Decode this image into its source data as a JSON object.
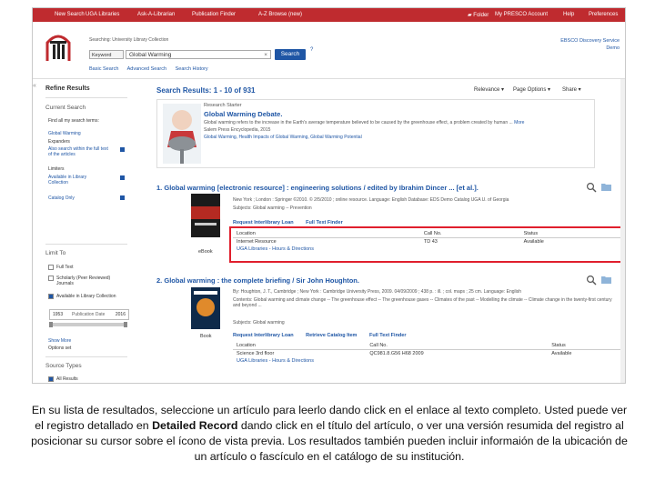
{
  "topbar": {
    "links_left": [
      "New Search",
      "UGA Libraries",
      "Ask-A-Librarian",
      "Publication Finder",
      "A-Z Browse (new)"
    ],
    "links_right": [
      "Folder",
      "My PRESCO Account",
      "Help",
      "Preferences"
    ]
  },
  "header": {
    "searching_label": "Searching: University Library Collection",
    "keyword_select": "Keyword",
    "search_value": "Global Warming",
    "clear_symbol": "×",
    "search_button": "Search",
    "help_symbol": "?",
    "subnav": [
      "Basic Search",
      "Advanced Search",
      "Search History"
    ],
    "eds_line1": "EBSCO Discovery Service",
    "eds_line2": "Demo"
  },
  "left_panel": {
    "collapse_symbol": "«",
    "title": "Refine Results",
    "current_search_label": "Current Search",
    "find_terms_label": "Find all my search terms:",
    "find_terms_value": "Global Warming",
    "expanders_label": "Expanders",
    "expander_item": "Also search within the full text of the articles",
    "limiters_label": "Limiters",
    "limiter_items": [
      "Available in Library Collection",
      "Catalog Only"
    ],
    "limit_to_label": "Limit To",
    "limit_to_items": [
      "Full Text",
      "Scholarly (Peer Reviewed) Journals",
      "Available in Library Collection"
    ],
    "date_from": "1953",
    "date_label": "Publication Date",
    "date_to": "2016",
    "show_more": "Show More",
    "options_set": "Options set",
    "source_types_label": "Source Types",
    "all_results": "All Results"
  },
  "results": {
    "header": "Search Results: 1 - 10 of 931",
    "relevance": "Relevance ▾",
    "page_options": "Page Options ▾",
    "share": "Share ▾",
    "research_starter": {
      "label": "Research Starter",
      "title": "Global Warming Debate.",
      "desc": "Global warming refers to the increase in the Earth's average temperature believed to be caused by the greenhouse effect, a problem created by human ...",
      "more": "More",
      "source": "Salem Press Encyclopedia, 2015",
      "subjects": "Global Warming, Health Impacts of Global Warming, Global Warming Potential"
    },
    "items": [
      {
        "num": "1.",
        "title": "Global warming [electronic resource] : engineering solutions / edited by Ibrahim Dincer ... [et al.].",
        "meta": "New York ; London : Springer ©2010. © 2/5/2010 ; online resource. Language: English Database: EDS Demo Catalog UGA U. of Georgia",
        "subjects": "Subjects: Global warming -- Prevention",
        "type": "eBook",
        "links": [
          "Request Interlibrary Loan",
          "Full Text Finder"
        ],
        "table_headers": [
          "Location",
          "Call No.",
          "Status"
        ],
        "table_row": [
          "Internet Resource",
          "TD 43",
          "Available"
        ],
        "table_sub": "UGA Libraries - Hours & Directions"
      },
      {
        "num": "2.",
        "title": "Global warming : the complete briefing / Sir John Houghton.",
        "meta": "By: Houghton, J. T., Cambridge ; New York : Cambridge University Press, 2009. 04/09/2009 ; 438 p. : ill. ; col. maps ; 25 cm. Language: English",
        "contents": "Contents: Global warming and climate change -- The greenhouse effect -- The greenhouse gases -- Climates of the past -- Modelling the climate -- Climate change in the twenty-first century and beyond ...",
        "subjects": "Subjects: Global warming",
        "type": "Book",
        "links": [
          "Request Interlibrary Loan",
          "Retrieve Catalog Item",
          "Full Text Finder"
        ],
        "table_headers": [
          "Location",
          "Call No.",
          "Status"
        ],
        "table_row": [
          "Science 3rd floor",
          "QC981.8.G56 H68 2009",
          "Available"
        ],
        "table_sub": "UGA Libraries - Hours & Directions"
      }
    ]
  },
  "caption": {
    "part1": "En su lista de resultados, seleccione un artículo para leerlo dando click en el enlace al texto completo. Usted puede ver el registro detallado en ",
    "bold": "Detailed Record",
    "part2": " dando click en el título del artículo, o ver una versión resumida del registro al posicionar su cursor sobre el ícono de vista previa. Los resultados también pueden incluir informaión de la ubicación de un  artículo o fascículo en el catálogo de su institución."
  },
  "colors": {
    "uga_red": "#bf2b2f",
    "link_blue": "#1f56a5",
    "highlight_red": "#e01f2d"
  },
  "icons": [
    "uga-arch-logo-icon",
    "folder-icon",
    "magnifier-preview-icon",
    "close-icon"
  ]
}
